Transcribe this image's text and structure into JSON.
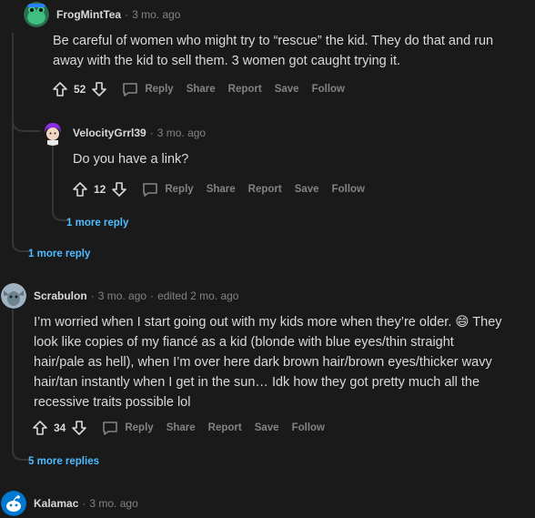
{
  "comments": [
    {
      "author": "FrogMintTea",
      "time": "3 mo. ago",
      "text": "Be careful of women who might try to “rescue” the kid. They do that and run away with the kid to sell them. 3 women got caught trying it.",
      "score": "52"
    },
    {
      "author": "VelocityGrrl39",
      "time": "3 mo. ago",
      "text": "Do you have a link?",
      "score": "12"
    },
    {
      "author": "Scrabulon",
      "time": "3 mo. ago",
      "edited": "edited 2 mo. ago",
      "text": "I’m worried when I start going out with my kids more when they’re older. 😄 They look like copies of my fiancé as a kid (blonde with blue eyes/thin straight hair/pale as hell), when I’m over here dark brown hair/brown eyes/thicker wavy hair/tan instantly when I get in the sun… Idk how they got pretty much all the recessive traits possible lol",
      "score": "34"
    },
    {
      "author": "Kalamac",
      "time": "3 mo. ago"
    }
  ],
  "actions": {
    "reply": "Reply",
    "share": "Share",
    "report": "Report",
    "save": "Save",
    "follow": "Follow"
  },
  "more": {
    "nested": "1 more reply",
    "outer": "1 more reply",
    "scrabulon": "5 more replies"
  },
  "separator": "·",
  "colors": {
    "background": "#1a1a1b",
    "text": "#d7dadc",
    "muted": "#818384",
    "link": "#4fbcff",
    "thread_line": "#343536"
  },
  "icons": [
    "frog-avatar-icon",
    "purple-hair-avatar-icon",
    "gray-creature-avatar-icon",
    "snoo-avatar-icon",
    "upvote-icon",
    "downvote-icon",
    "reply-bubble-icon"
  ]
}
